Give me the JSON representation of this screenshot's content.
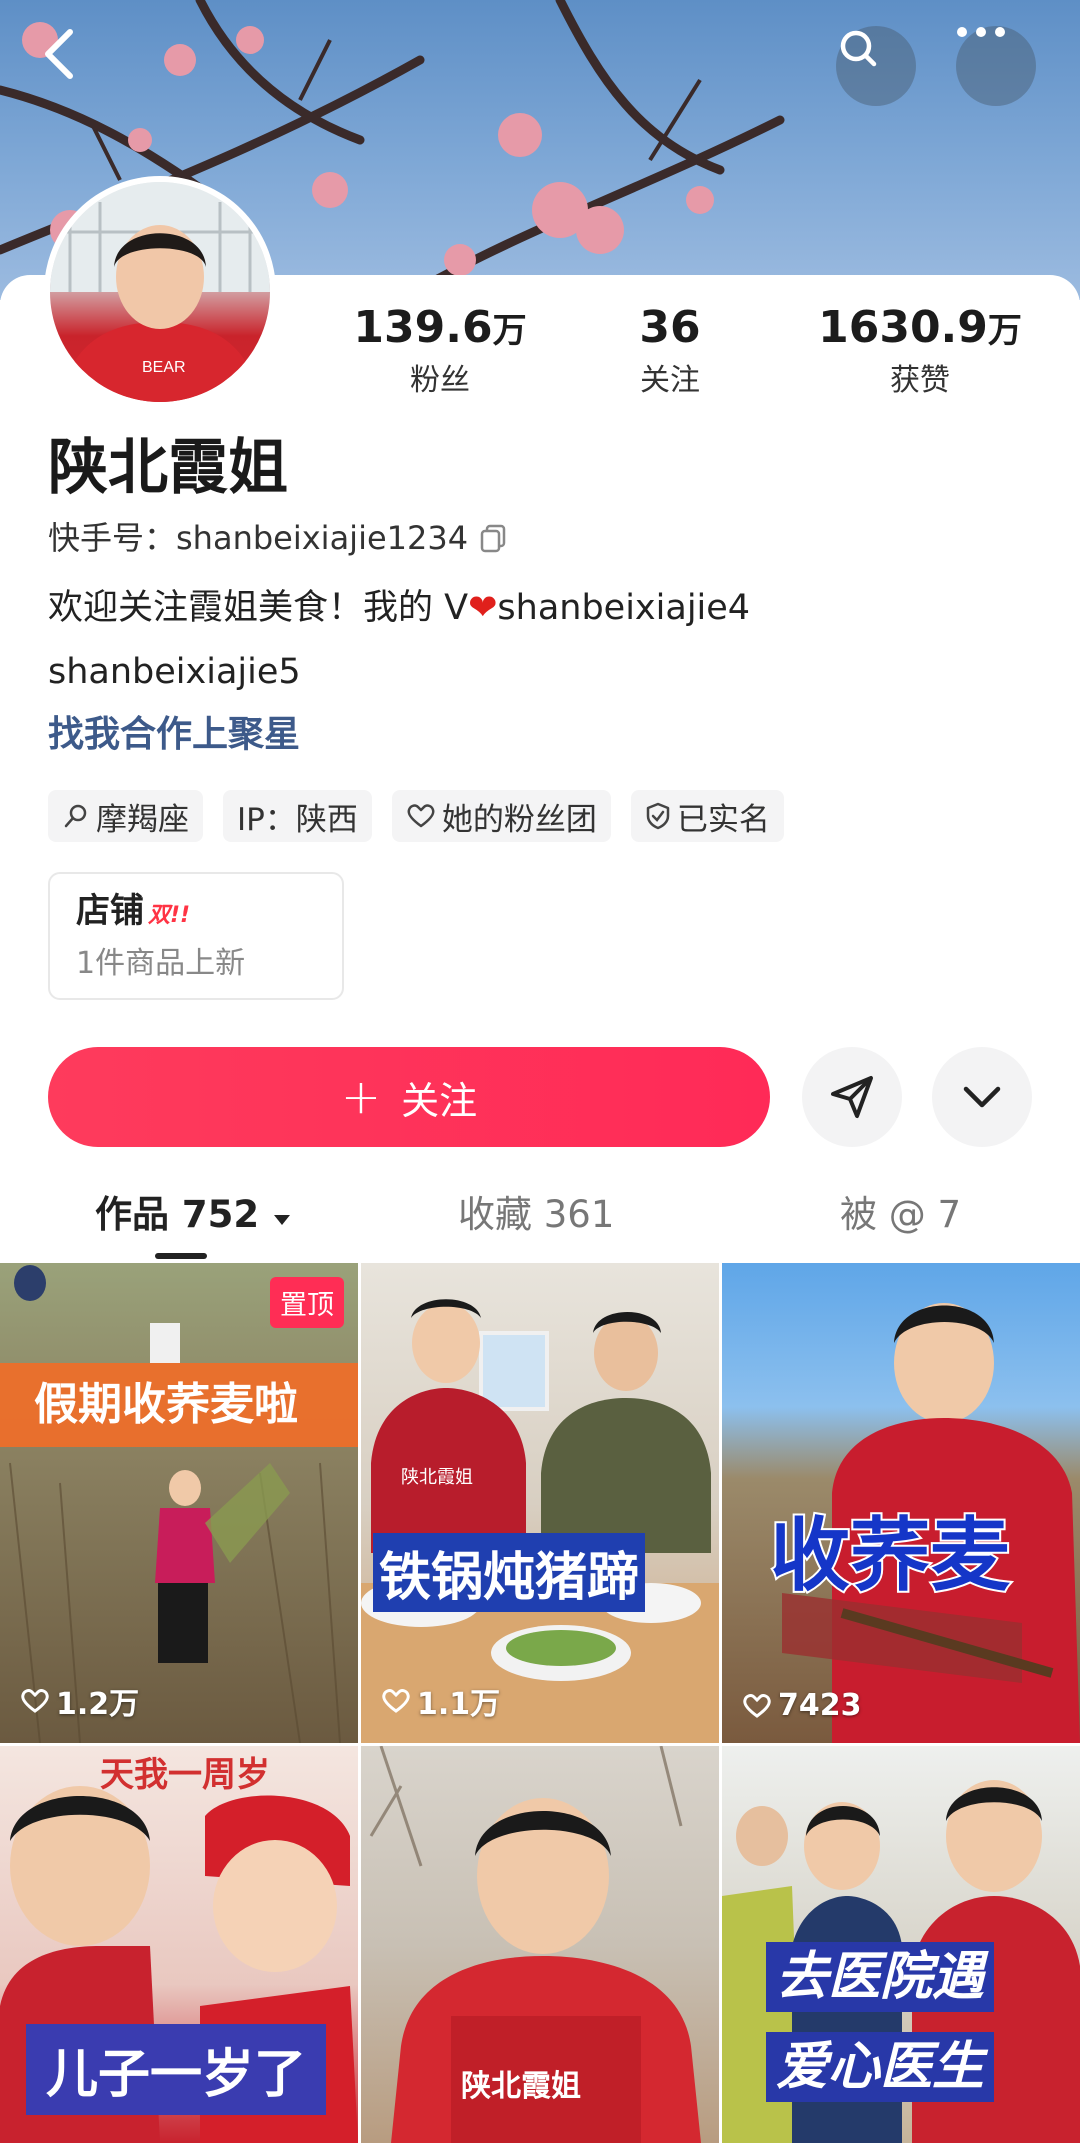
{
  "profile": {
    "name": "陕北霞姐",
    "kuaishou_id": "快手号：shanbeixiajie1234",
    "bio_line1_a": "欢迎关注霞姐美食！我的 V",
    "bio_heart": "❤",
    "bio_line1_b": "shanbeixiajie4",
    "bio_line2": "shanbeixiajie5",
    "collab_link": "找我合作上聚星"
  },
  "stats": [
    {
      "value": "139.6",
      "unit": "万",
      "label": "粉丝"
    },
    {
      "value": "36",
      "unit": "",
      "label": "关注"
    },
    {
      "value": "1630.9",
      "unit": "万",
      "label": "获赞"
    }
  ],
  "tags": [
    {
      "icon": "constellation-icon",
      "label": "摩羯座"
    },
    {
      "icon": "",
      "label": "IP：陕西"
    },
    {
      "icon": "heart-outline-icon",
      "label": "她的粉丝团"
    },
    {
      "icon": "shield-check-icon",
      "label": "已实名"
    }
  ],
  "shop": {
    "title": "店铺",
    "badge": "双!!",
    "subtitle": "1件商品上新"
  },
  "actions": {
    "follow_label": "关注",
    "follow_plus": "+"
  },
  "tabs": [
    {
      "label": "作品 752",
      "active": true
    },
    {
      "label": "收藏 361",
      "active": false
    },
    {
      "label": "被 @ 7",
      "active": false
    }
  ],
  "grid": [
    {
      "caption": "假期收荞麦啦",
      "likes": "1.2万",
      "pinned": "置顶"
    },
    {
      "caption": "铁锅炖猪蹄",
      "likes": "1.1万",
      "apron_text": "陕北霞姐"
    },
    {
      "caption": "收荞麦",
      "likes": "7423"
    },
    {
      "caption": "儿子一岁了",
      "banner": "天我一周岁"
    },
    {
      "caption": "",
      "apron_text": "陕北霞姐"
    },
    {
      "caption_line1": "去医院遇",
      "caption_line2": "爱心医生"
    }
  ],
  "colors": {
    "accent": "#fe2c55",
    "link": "#3d5a8a"
  }
}
